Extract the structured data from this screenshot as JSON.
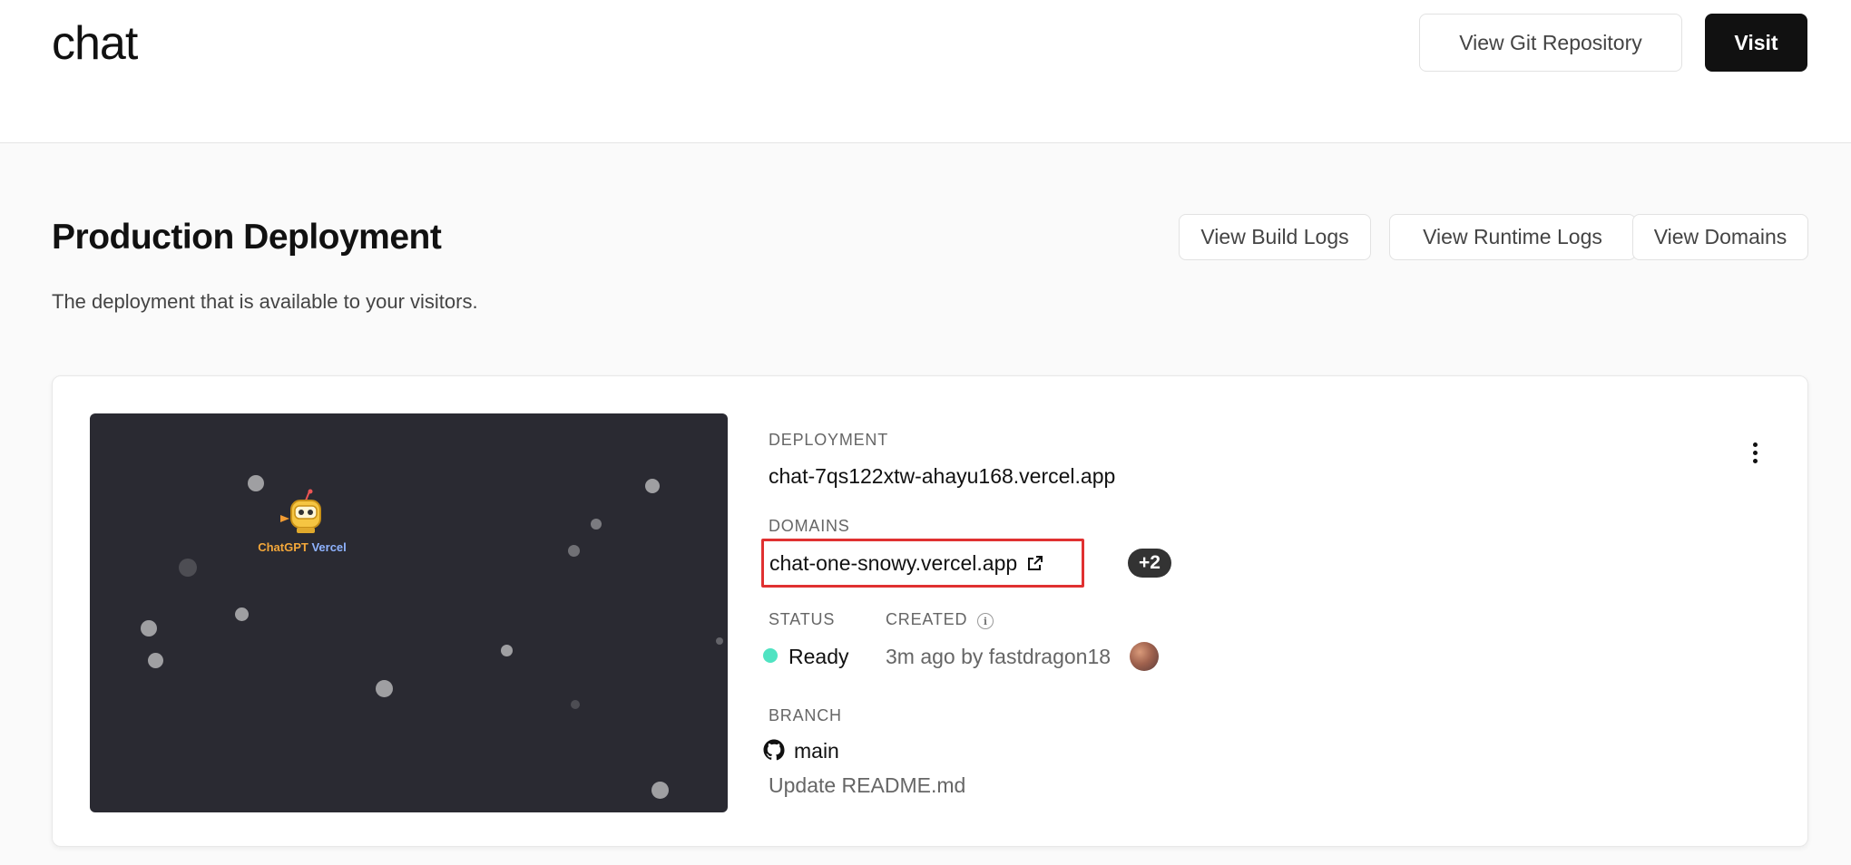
{
  "header": {
    "project_title": "chat",
    "view_git_label": "View Git Repository",
    "visit_label": "Visit"
  },
  "section": {
    "title": "Production Deployment",
    "subtitle": "The deployment that is available to your visitors.",
    "build_logs_label": "View Build Logs",
    "runtime_logs_label": "View Runtime Logs",
    "domains_label": "View Domains"
  },
  "deployment": {
    "preview_logo_text_a": "ChatGPT",
    "preview_logo_text_b": "Vercel",
    "deployment_label": "DEPLOYMENT",
    "deployment_url": "chat-7qs122xtw-ahayu168.vercel.app",
    "domains_label": "DOMAINS",
    "domain": "chat-one-snowy.vercel.app",
    "domains_extra": "+2",
    "status_label": "STATUS",
    "status_value": "Ready",
    "created_label": "CREATED",
    "created_value": "3m ago by fastdragon18",
    "branch_label": "BRANCH",
    "branch_name": "main",
    "commit_message": "Update README.md"
  },
  "colors": {
    "status_ready": "#50e3c2",
    "highlight_box": "#e03131",
    "primary_button": "#111111"
  },
  "icons": {
    "external_link": "external-link-icon",
    "info": "info-icon",
    "github": "github-icon",
    "more": "more-vertical-icon"
  }
}
